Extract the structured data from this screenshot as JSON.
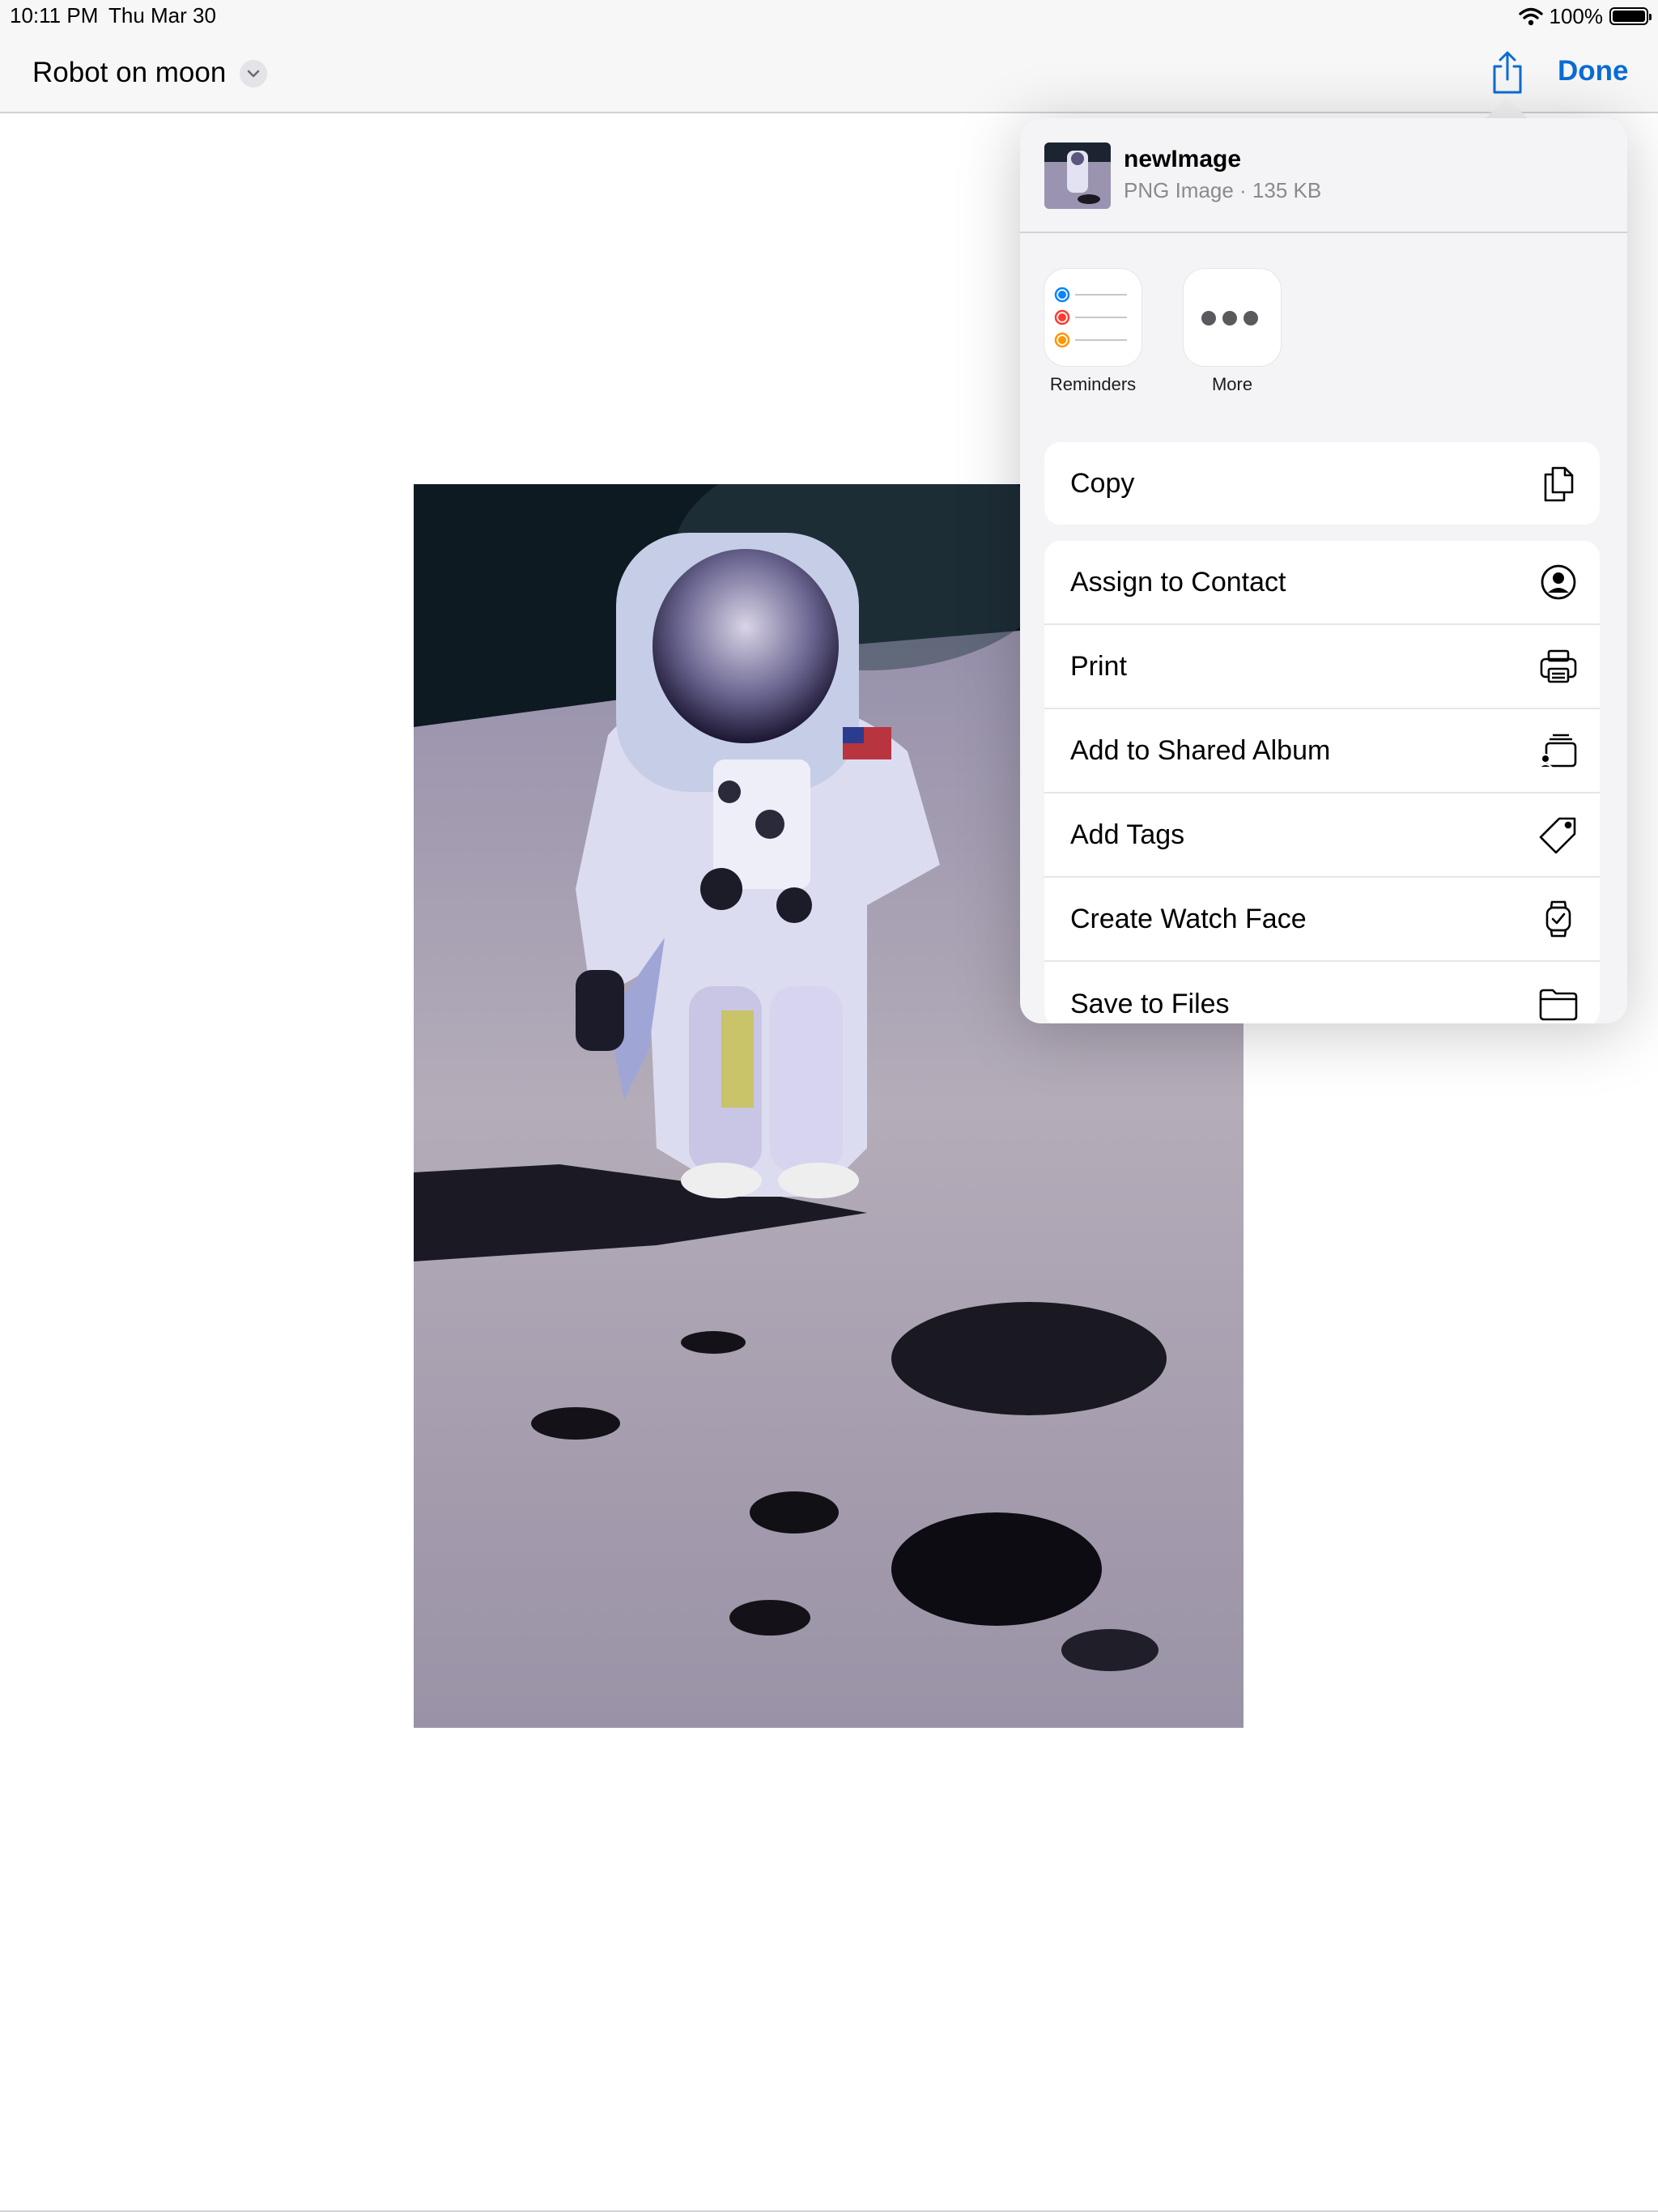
{
  "status_bar": {
    "time": "10:11 PM",
    "date": "Thu Mar 30",
    "battery": "100%"
  },
  "nav": {
    "title": "Robot on moon",
    "done_label": "Done"
  },
  "share_sheet": {
    "file_name": "newImage",
    "file_info": "PNG Image · 135 KB",
    "apps": [
      {
        "label": "Reminders",
        "icon": "reminders-icon"
      },
      {
        "label": "More",
        "icon": "more-icon"
      }
    ],
    "actions_group1": [
      {
        "label": "Copy",
        "icon": "copy-icon"
      }
    ],
    "actions_group2": [
      {
        "label": "Assign to Contact",
        "icon": "person-circle-icon"
      },
      {
        "label": "Print",
        "icon": "printer-icon"
      },
      {
        "label": "Add to Shared Album",
        "icon": "shared-album-icon"
      },
      {
        "label": "Add Tags",
        "icon": "tag-icon"
      },
      {
        "label": "Create Watch Face",
        "icon": "watch-face-icon"
      },
      {
        "label": "Save to Files",
        "icon": "folder-icon"
      }
    ]
  },
  "colors": {
    "accent": "#0a6cd6",
    "sheet_bg": "#f4f4f6",
    "separator": "#d1d1d6"
  }
}
